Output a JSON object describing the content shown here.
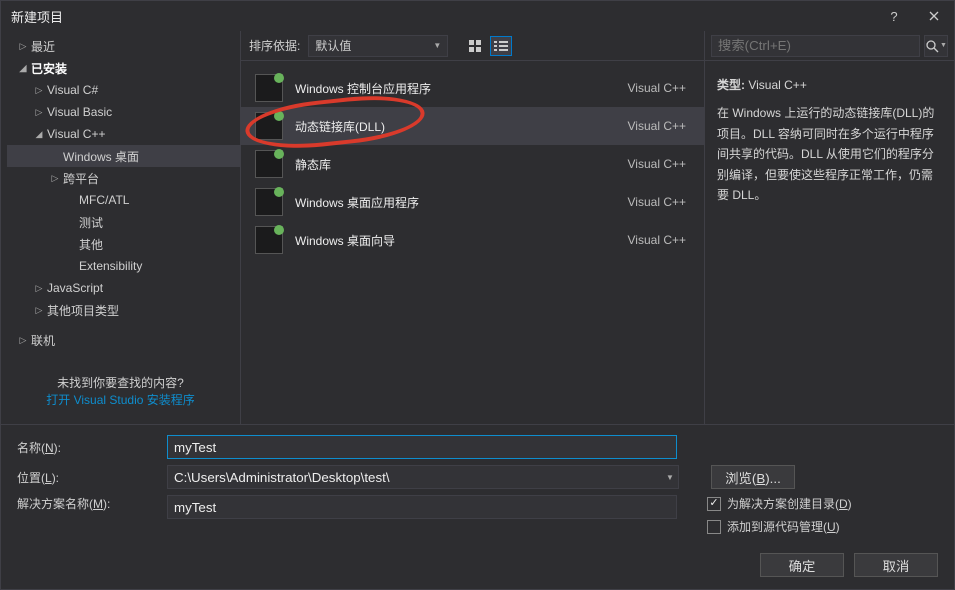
{
  "title": "新建项目",
  "sidebar": {
    "recent": "最近",
    "installed": "已安装",
    "langs": {
      "csharp": "Visual C#",
      "vb": "Visual Basic",
      "vcpp": "Visual C++",
      "vcpp_children": {
        "desktop": "Windows 桌面",
        "cross": "跨平台",
        "mfc": "MFC/ATL",
        "test": "测试",
        "other": "其他",
        "ext": "Extensibility"
      },
      "js": "JavaScript",
      "otherproj": "其他项目类型"
    },
    "online": "联机",
    "nofound": "未找到你要查找的内容?",
    "open_installer": "打开 Visual Studio 安装程序"
  },
  "toolbar": {
    "sort_label": "排序依据:",
    "sort_value": "默认值"
  },
  "templates": [
    {
      "name": "Windows 控制台应用程序",
      "lang": "Visual C++"
    },
    {
      "name": "动态链接库(DLL)",
      "lang": "Visual C++",
      "selected": true
    },
    {
      "name": "静态库",
      "lang": "Visual C++"
    },
    {
      "name": "Windows 桌面应用程序",
      "lang": "Visual C++"
    },
    {
      "name": "Windows 桌面向导",
      "lang": "Visual C++"
    }
  ],
  "search": {
    "placeholder": "搜索(Ctrl+E)"
  },
  "desc": {
    "type_label": "类型:",
    "type_value": "Visual C++",
    "text": "在 Windows 上运行的动态链接库(DLL)的项目。DLL 容纳可同时在多个运行中程序间共享的代码。DLL 从使用它们的程序分别编译，但要使这些程序正常工作，仍需要 DLL。"
  },
  "form": {
    "name_lbl": "名称(N):",
    "name_val": "myTest",
    "loc_lbl": "位置(L):",
    "loc_val": "C:\\Users\\Administrator\\Desktop\\test\\",
    "sol_lbl": "解决方案名称(M):",
    "sol_val": "myTest",
    "browse": "浏览(B)...",
    "create_dir": "为解决方案创建目录(D)",
    "add_src": "添加到源代码管理(U)"
  },
  "buttons": {
    "ok": "确定",
    "cancel": "取消"
  }
}
